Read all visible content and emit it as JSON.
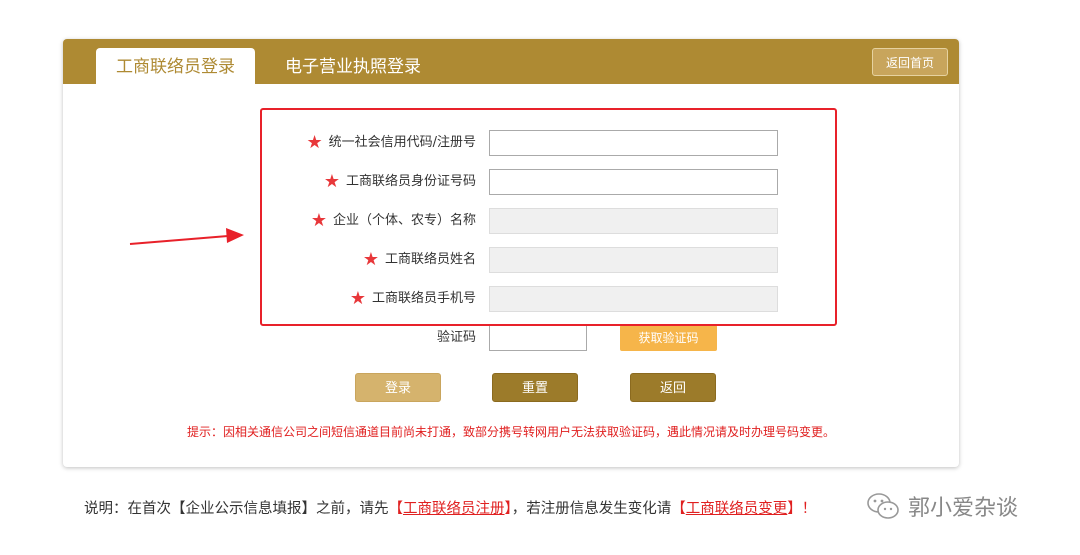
{
  "header": {
    "tabs": [
      {
        "label": "工商联络员登录",
        "active": true
      },
      {
        "label": "电子营业执照登录",
        "active": false
      }
    ],
    "home_button": "返回首页"
  },
  "form": {
    "fields": [
      {
        "label": "统一社会信用代码/注册号",
        "required": true,
        "value": "",
        "disabled": false
      },
      {
        "label": "工商联络员身份证号码",
        "required": true,
        "value": "",
        "disabled": false
      },
      {
        "label": "企业（个体、农专）名称",
        "required": true,
        "value": "",
        "disabled": true
      },
      {
        "label": "工商联络员姓名",
        "required": true,
        "value": "",
        "disabled": true
      },
      {
        "label": "工商联络员手机号",
        "required": true,
        "value": "",
        "disabled": true
      }
    ],
    "captcha_label": "验证码",
    "captcha_value": "",
    "get_code_button": "获取验证码",
    "star": "★"
  },
  "actions": {
    "login": "登录",
    "reset": "重置",
    "back": "返回"
  },
  "tip": "提示：因相关通信公司之间短信通道目前尚未打通，致部分携号转网用户无法获取验证码，遇此情况请及时办理号码变更。",
  "note": {
    "prefix": "说明：在首次【企业公示信息填报】之前，请先",
    "link1_open": "【",
    "link1": "工商联络员注册",
    "link1_close": "】",
    "middle": "，若注册信息发生变化请",
    "link2_open": "【",
    "link2": "工商联络员变更",
    "link2_close": "】",
    "suffix": "！"
  },
  "watermark": "郭小爱杂谈",
  "colors": {
    "brand": "#ae8a33",
    "highlight": "#e8212a",
    "get_code": "#f6b54a"
  }
}
